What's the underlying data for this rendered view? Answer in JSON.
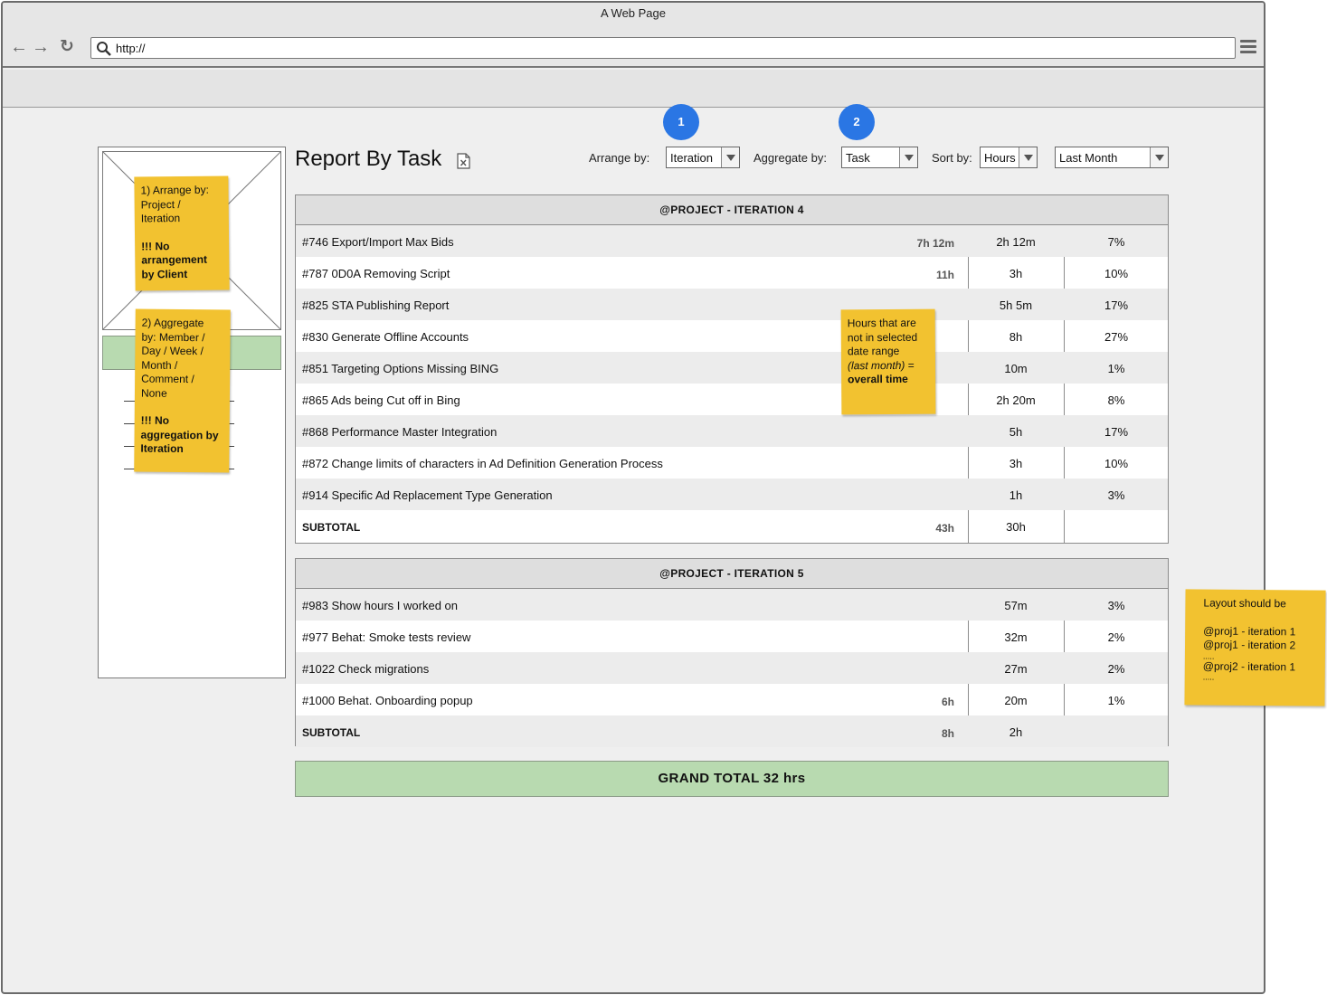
{
  "window": {
    "title": "A Web Page"
  },
  "browser": {
    "url": "http://"
  },
  "report": {
    "title": "Report By Task"
  },
  "controls": {
    "arrange_label": "Arrange by:",
    "arrange_value": "Iteration",
    "aggregate_label": "Aggregate by:",
    "aggregate_value": "Task",
    "sort_label": "Sort by:",
    "sort_value": "Hours",
    "range_value": "Last Month"
  },
  "badges": {
    "one": "1",
    "two": "2"
  },
  "colors": {
    "badge": "#2a76e4",
    "note": "#f2c230",
    "total": "#b8dab0"
  },
  "tables": [
    {
      "header": "@PROJECT - ITERATION 4",
      "rows": [
        {
          "task": "#746 Export/Import Max Bids",
          "overall": "7h 12m",
          "hours": "2h 12m",
          "pct": "7%"
        },
        {
          "task": "#787 0D0A Removing Script",
          "overall": "11h",
          "hours": "3h",
          "pct": "10%"
        },
        {
          "task": "#825 STA Publishing Report",
          "overall": "",
          "hours": "5h 5m",
          "pct": "17%"
        },
        {
          "task": "#830 Generate Offline Accounts",
          "overall": "",
          "hours": "8h",
          "pct": "27%"
        },
        {
          "task": "#851 Targeting Options Missing BING",
          "overall": "",
          "hours": "10m",
          "pct": "1%"
        },
        {
          "task": "#865 Ads being Cut off in Bing",
          "overall": "",
          "hours": "2h 20m",
          "pct": "8%"
        },
        {
          "task": "#868 Performance Master Integration",
          "overall": "",
          "hours": "5h",
          "pct": "17%"
        },
        {
          "task": "#872 Change limits of characters in Ad Definition Generation Process",
          "overall": "",
          "hours": "3h",
          "pct": "10%"
        },
        {
          "task": "#914 Specific Ad Replacement Type Generation",
          "overall": "",
          "hours": "1h",
          "pct": "3%"
        }
      ],
      "subtotal": {
        "label": "SUBTOTAL",
        "overall": "43h",
        "hours": "30h"
      }
    },
    {
      "header": "@PROJECT - ITERATION 5",
      "rows": [
        {
          "task": "#983 Show hours I worked on",
          "overall": "",
          "hours": "57m",
          "pct": "3%"
        },
        {
          "task": "#977 Behat: Smoke tests review",
          "overall": "",
          "hours": "32m",
          "pct": "2%"
        },
        {
          "task": "#1022 Check migrations",
          "overall": "",
          "hours": "27m",
          "pct": "2%"
        },
        {
          "task": "#1000 Behat. Onboarding popup",
          "overall": "6h",
          "hours": "20m",
          "pct": "1%"
        }
      ],
      "subtotal": {
        "label": "SUBTOTAL",
        "overall": "8h",
        "hours": "2h"
      }
    }
  ],
  "grand_total": "GRAND TOTAL 32 hrs",
  "notes": {
    "arrange": {
      "line1": "1) Arrange by:",
      "line2": "Project /",
      "line3": "Iteration",
      "warn1": "!!! No",
      "warn2": "arrangement",
      "warn3": "by Client"
    },
    "aggregate": {
      "line1": "2) Aggregate",
      "line2": "by: Member /",
      "line3": "Day / Week /",
      "line4": "Month /",
      "line5": "Comment /",
      "line6": "None",
      "warn1": "!!! No",
      "warn2": "aggregation by",
      "warn3": "Iteration"
    },
    "hours": {
      "line1": "Hours that are",
      "line2": "not in selected",
      "line3": "date range",
      "line4_italic": "(last month)",
      "line4_rest": " =",
      "line5": "overall time"
    },
    "layout": {
      "line1": "Layout should be",
      "line2": "@proj1 - iteration 1",
      "line3": "@proj1 - iteration 2",
      "line4": ".....",
      "line5": "@proj2 - iteration 1",
      "line6": "....."
    }
  }
}
